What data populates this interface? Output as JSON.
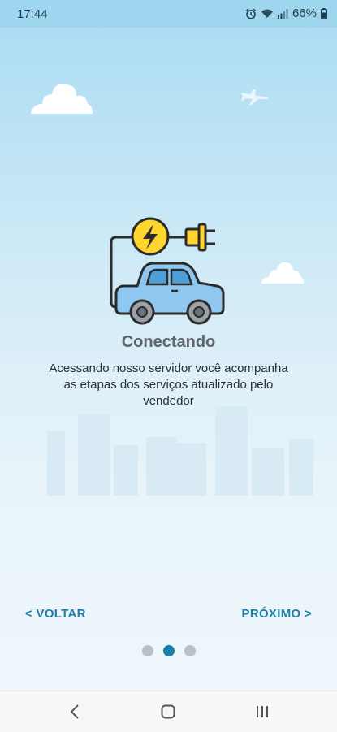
{
  "status_bar": {
    "time": "17:44",
    "battery": "66%"
  },
  "onboarding": {
    "title": "Conectando",
    "description": "Acessando nosso servidor você acompanha as etapas dos serviços atualizado pelo vendedor",
    "back_label": "< VOLTAR",
    "next_label": "PRÓXIMO >",
    "page_indicator": {
      "total": 3,
      "current": 2
    }
  },
  "colors": {
    "accent": "#1b7fa8",
    "title": "#5e6468",
    "car_body": "#8ec7ef",
    "bolt_circle": "#ffd630"
  },
  "icons": {
    "status": [
      "alarm-icon",
      "wifi-icon",
      "signal-icon",
      "battery-icon"
    ],
    "illustration": "electric-car-charging-icon",
    "system_nav": [
      "back-icon",
      "home-icon",
      "recent-apps-icon"
    ]
  }
}
